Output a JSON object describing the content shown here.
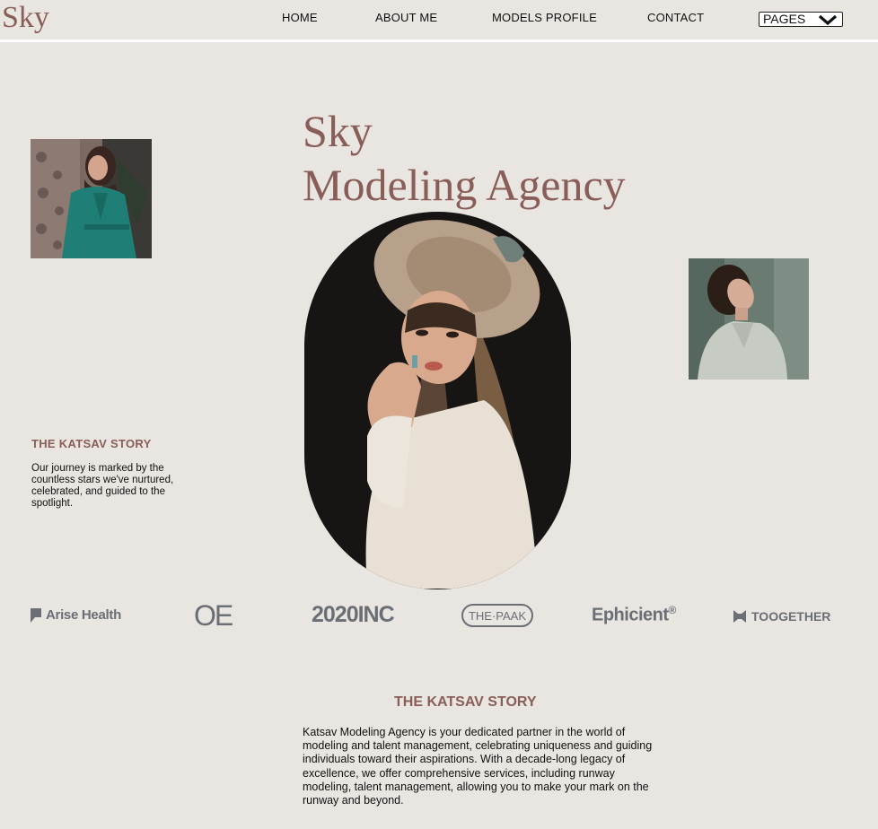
{
  "header": {
    "logo": "Sky",
    "nav": [
      {
        "label": "HOME"
      },
      {
        "label": "ABOUT ME"
      },
      {
        "label": "MODELS PROFILE"
      },
      {
        "label": "CONTACT"
      }
    ],
    "pages_select": "PAGES"
  },
  "hero": {
    "title_line1": "Sky",
    "title_line2": "Modeling Agency"
  },
  "story_left": {
    "heading": "THE KATSAV STORY",
    "text": "Our journey is marked by the countless stars we've nurtured, celebrated, and guided to the spotlight."
  },
  "brands": {
    "arise": "Arise Health",
    "oe": "OE",
    "inc": "2020INC",
    "paak": "THE·PAAK",
    "ephicient": "Ephicient",
    "ephicient_mark": "®",
    "toogether": "TOOGETHER"
  },
  "story": {
    "heading": "THE KATSAV STORY",
    "text": "Katsav Modeling Agency is your dedicated partner in the world of modeling and talent management, celebrating uniqueness and guiding individuals toward their aspirations. With a decade-long legacy of excellence, we offer comprehensive services, including runway modeling, talent management, allowing you to make your mark on the runway and beyond."
  },
  "colors": {
    "background": "#e9e5e1",
    "accent": "#8a5e58",
    "brand_gray": "#6b6f75"
  },
  "icons": {
    "pages_chevron": "chevron-down-icon",
    "arise_mark": "flag-icon",
    "toogether_mark": "bowtie-icon"
  }
}
